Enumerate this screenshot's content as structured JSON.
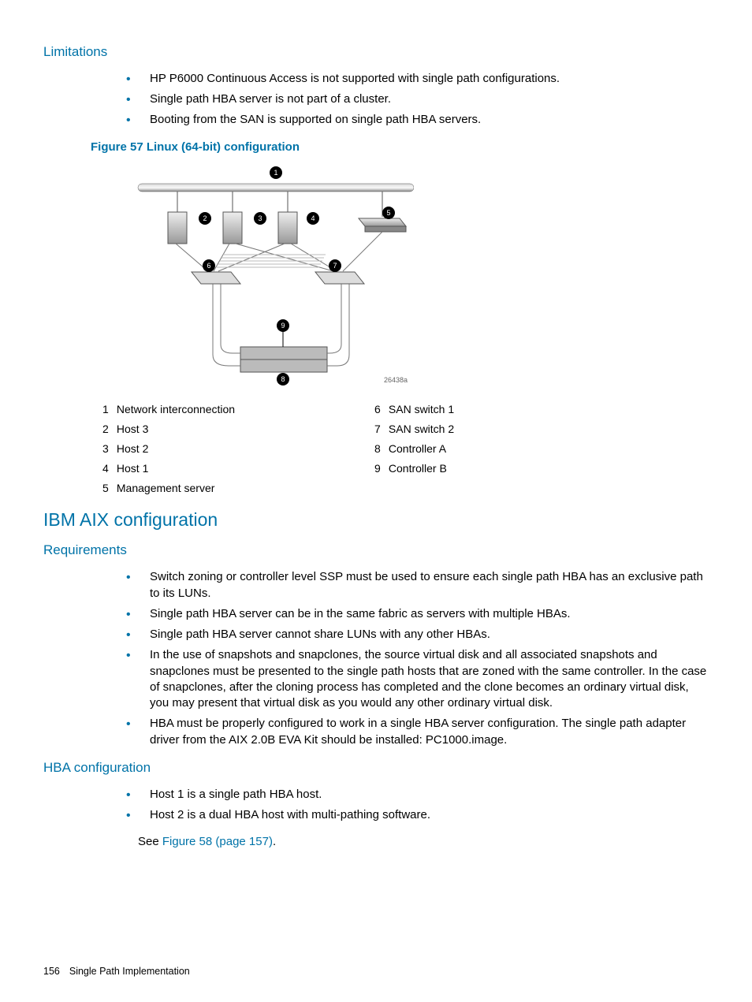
{
  "sections": {
    "limitations": {
      "title": "Limitations",
      "items": [
        "HP P6000 Continuous Access is not supported with single path configurations.",
        "Single path HBA server is not part of a cluster.",
        "Booting from the SAN is supported on single path HBA servers."
      ]
    },
    "figure": {
      "caption": "Figure 57 Linux (64-bit) configuration",
      "ref": "26438a",
      "legend_left": [
        {
          "n": "1",
          "t": "Network interconnection"
        },
        {
          "n": "2",
          "t": "Host 3"
        },
        {
          "n": "3",
          "t": "Host 2"
        },
        {
          "n": "4",
          "t": "Host 1"
        },
        {
          "n": "5",
          "t": "Management server"
        }
      ],
      "legend_right": [
        {
          "n": "6",
          "t": "SAN switch 1"
        },
        {
          "n": "7",
          "t": "SAN switch 2"
        },
        {
          "n": "8",
          "t": "Controller A"
        },
        {
          "n": "9",
          "t": "Controller B"
        }
      ]
    },
    "ibm": {
      "title": "IBM AIX configuration",
      "req_title": "Requirements",
      "req_items": [
        "Switch zoning or controller level SSP must be used to ensure each single path HBA has an exclusive path to its LUNs.",
        "Single path HBA server can be in the same fabric as servers with multiple HBAs.",
        "Single path HBA server cannot share LUNs with any other HBAs.",
        "In the use of snapshots and snapclones, the source virtual disk and all associated snapshots and snapclones must be presented to the single path hosts that are zoned with the same controller. In the case of snapclones, after the cloning process has completed and the clone becomes an ordinary virtual disk, you may present that virtual disk as you would any other ordinary virtual disk.",
        "HBA must be properly configured to work in a single HBA server configuration. The single path adapter driver from the AIX 2.0B EVA Kit should be installed: PC1000.image."
      ],
      "hba_title": "HBA configuration",
      "hba_items": [
        "Host 1 is a single path HBA host.",
        "Host 2 is a dual HBA host with multi-pathing software."
      ],
      "see_prefix": "See ",
      "see_link": "Figure 58 (page 157)",
      "see_suffix": "."
    }
  },
  "footer": {
    "page": "156",
    "title": "Single Path Implementation"
  }
}
